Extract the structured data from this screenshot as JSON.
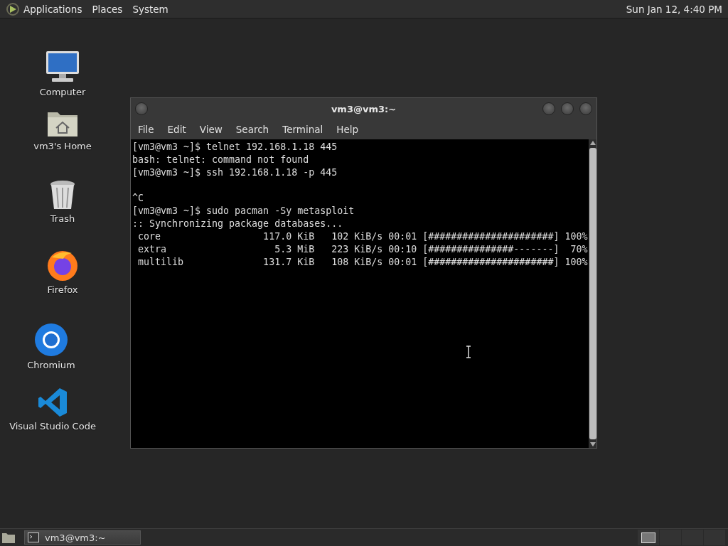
{
  "top_panel": {
    "menus": [
      "Applications",
      "Places",
      "System"
    ],
    "clock": "Sun Jan 12,  4:40 PM"
  },
  "desktop_icons": [
    {
      "label": "Computer",
      "kind": "computer"
    },
    {
      "label": "vm3's Home",
      "kind": "home"
    },
    {
      "label": "Trash",
      "kind": "trash"
    },
    {
      "label": "Firefox",
      "kind": "firefox"
    },
    {
      "label": "Chromium",
      "kind": "chromium"
    },
    {
      "label": "Visual Studio Code",
      "kind": "vscode"
    }
  ],
  "terminal": {
    "title": "vm3@vm3:~",
    "menu": [
      "File",
      "Edit",
      "View",
      "Search",
      "Terminal",
      "Help"
    ],
    "lines": [
      {
        "text": "[vm3@vm3 ~]$ telnet 192.168.1.18 445",
        "blank_before": false
      },
      {
        "text": "bash: telnet: command not found",
        "blank_before": false
      },
      {
        "text": "[vm3@vm3 ~]$ ssh 192.168.1.18 -p 445",
        "blank_before": false
      },
      {
        "text": "^C",
        "blank_before": true
      },
      {
        "text": "[vm3@vm3 ~]$ sudo pacman -Sy metasploit",
        "blank_before": false
      },
      {
        "text": ":: Synchronizing package databases...",
        "blank_before": false
      },
      {
        "text": " core                  117.0 KiB   102 KiB/s 00:01 [######################] 100%",
        "blank_before": false
      },
      {
        "text": " extra                   5.3 MiB   223 KiB/s 00:10 [###############-------]  70%",
        "blank_before": false
      },
      {
        "text": " multilib              131.7 KiB   108 KiB/s 00:01 [######################] 100%",
        "blank_before": false
      }
    ]
  },
  "taskbar": {
    "tasks": [
      {
        "label": "vm3@vm3:~",
        "selected": true
      }
    ]
  }
}
